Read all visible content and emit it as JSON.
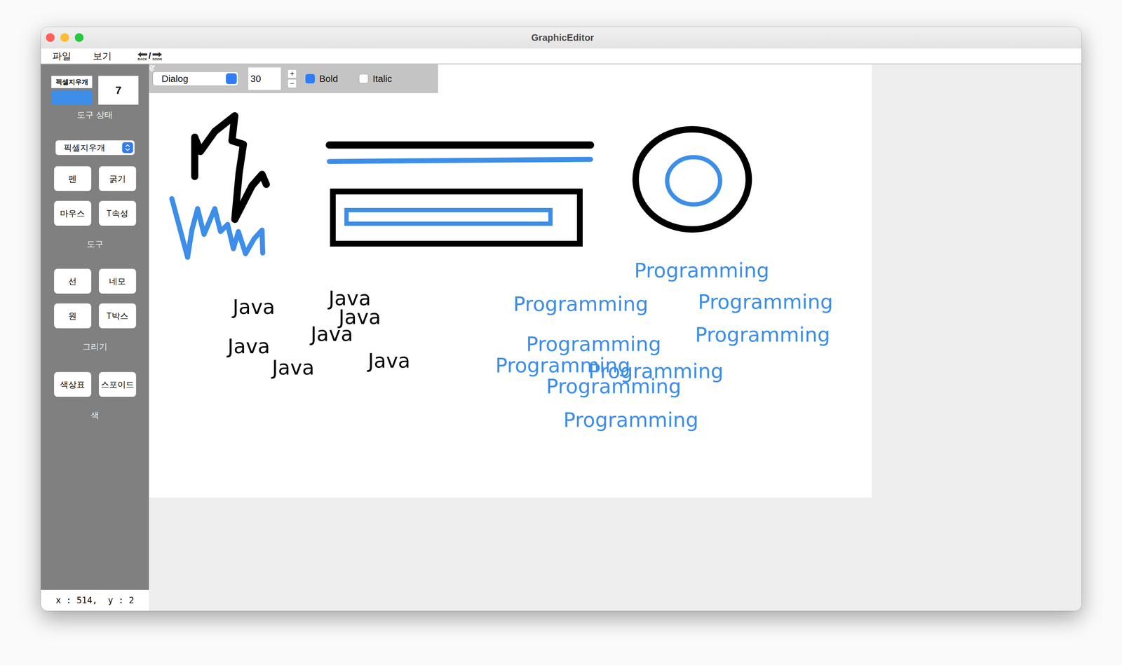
{
  "window": {
    "title": "GraphicEditor"
  },
  "menu": [
    {
      "label": "파일"
    },
    {
      "label": "보기"
    }
  ],
  "history": {
    "back": "BACK",
    "separator": "/",
    "forward": "SOON"
  },
  "font_toolbar": {
    "font": "Dialog",
    "size": "30",
    "plus": "+",
    "minus": "−",
    "bold": {
      "label": "Bold",
      "checked": true
    },
    "italic": {
      "label": "Italic",
      "checked": false
    }
  },
  "tool_status": {
    "tool": "픽셀지우개",
    "current_color": "#3d8ee9",
    "thickness": "7",
    "label": "도구 상태"
  },
  "tool_select": {
    "value": "픽셀지우개"
  },
  "groups": [
    {
      "label": "도구",
      "buttons": [
        "펜",
        "굵기",
        "마우스",
        "T속성"
      ]
    },
    {
      "label": "그리기",
      "buttons": [
        "선",
        "네모",
        "원",
        "T박스"
      ]
    },
    {
      "label": "색",
      "buttons": [
        "색상표",
        "스포이드"
      ]
    }
  ],
  "canvas": {
    "shapes": [
      {
        "kind": "freehand",
        "color": "#000000"
      },
      {
        "kind": "freehand",
        "color": "#3d8ee9"
      },
      {
        "kind": "line",
        "color": "#000000"
      },
      {
        "kind": "line",
        "color": "#3d8ee9"
      },
      {
        "kind": "rect",
        "color": "#000000"
      },
      {
        "kind": "rect",
        "color": "#3d8ee9"
      },
      {
        "kind": "ellipse",
        "color": "#000000"
      },
      {
        "kind": "ellipse",
        "color": "#3d8ee9"
      }
    ],
    "texts": [
      {
        "text": "Java",
        "color": "#000000"
      },
      {
        "text": "Java",
        "color": "#000000"
      },
      {
        "text": "Java",
        "color": "#000000"
      },
      {
        "text": "Java",
        "color": "#000000"
      },
      {
        "text": "Java",
        "color": "#000000"
      },
      {
        "text": "Java",
        "color": "#000000"
      },
      {
        "text": "Java",
        "color": "#000000"
      },
      {
        "text": "Programming",
        "color": "#3d8ee9"
      },
      {
        "text": "Programming",
        "color": "#3d8ee9"
      },
      {
        "text": "Programming",
        "color": "#3d8ee9"
      },
      {
        "text": "Programming",
        "color": "#3d8ee9"
      },
      {
        "text": "Programming",
        "color": "#3d8ee9"
      },
      {
        "text": "Programming",
        "color": "#3d8ee9"
      },
      {
        "text": "Programming",
        "color": "#3d8ee9"
      },
      {
        "text": "Programming",
        "color": "#3d8ee9"
      },
      {
        "text": "Programming",
        "color": "#3d8ee9"
      }
    ]
  },
  "status_bar": {
    "text": "x : 514,  y : 2"
  }
}
